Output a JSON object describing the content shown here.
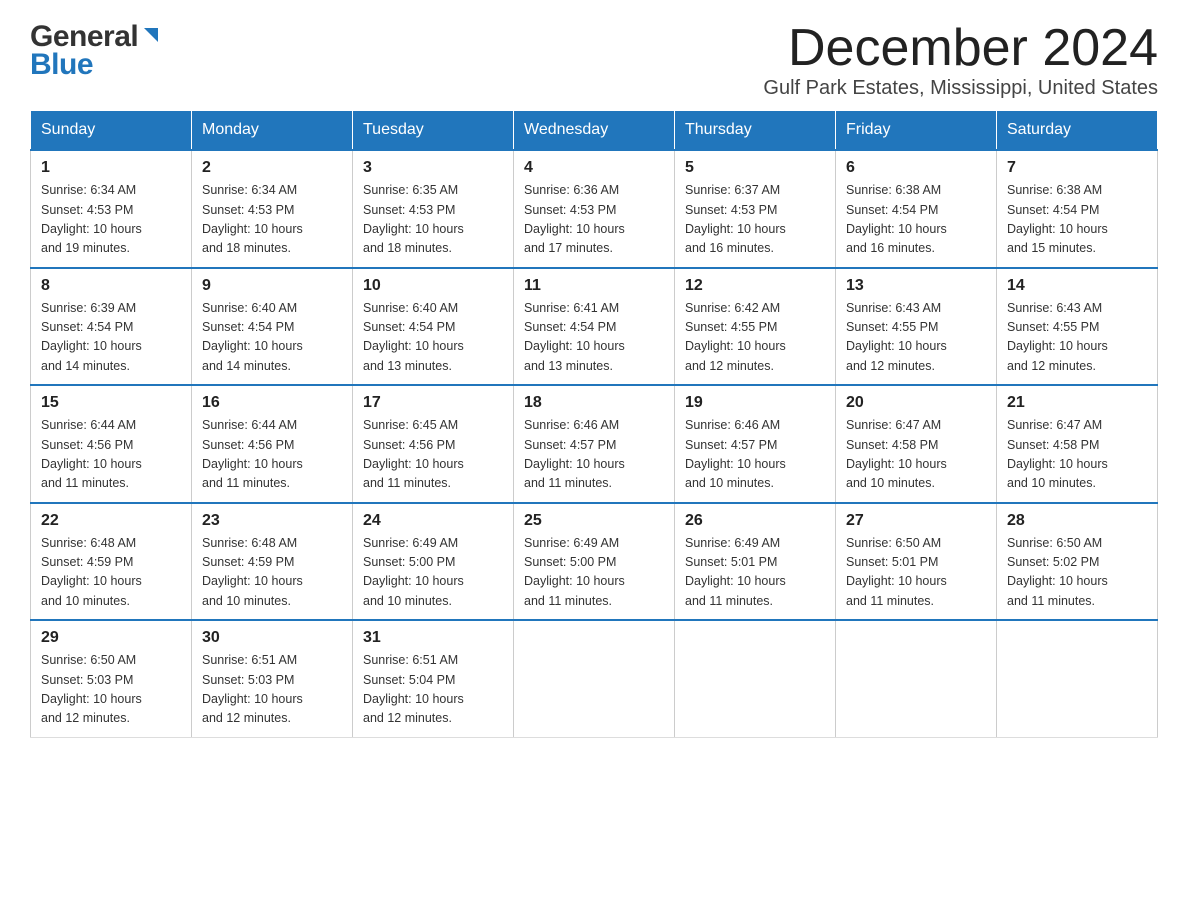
{
  "header": {
    "logo_general": "General",
    "logo_blue": "Blue",
    "month_title": "December 2024",
    "location": "Gulf Park Estates, Mississippi, United States"
  },
  "days_of_week": [
    "Sunday",
    "Monday",
    "Tuesday",
    "Wednesday",
    "Thursday",
    "Friday",
    "Saturday"
  ],
  "weeks": [
    [
      {
        "day": "1",
        "sunrise": "6:34 AM",
        "sunset": "4:53 PM",
        "daylight": "10 hours and 19 minutes."
      },
      {
        "day": "2",
        "sunrise": "6:34 AM",
        "sunset": "4:53 PM",
        "daylight": "10 hours and 18 minutes."
      },
      {
        "day": "3",
        "sunrise": "6:35 AM",
        "sunset": "4:53 PM",
        "daylight": "10 hours and 18 minutes."
      },
      {
        "day": "4",
        "sunrise": "6:36 AM",
        "sunset": "4:53 PM",
        "daylight": "10 hours and 17 minutes."
      },
      {
        "day": "5",
        "sunrise": "6:37 AM",
        "sunset": "4:53 PM",
        "daylight": "10 hours and 16 minutes."
      },
      {
        "day": "6",
        "sunrise": "6:38 AM",
        "sunset": "4:54 PM",
        "daylight": "10 hours and 16 minutes."
      },
      {
        "day": "7",
        "sunrise": "6:38 AM",
        "sunset": "4:54 PM",
        "daylight": "10 hours and 15 minutes."
      }
    ],
    [
      {
        "day": "8",
        "sunrise": "6:39 AM",
        "sunset": "4:54 PM",
        "daylight": "10 hours and 14 minutes."
      },
      {
        "day": "9",
        "sunrise": "6:40 AM",
        "sunset": "4:54 PM",
        "daylight": "10 hours and 14 minutes."
      },
      {
        "day": "10",
        "sunrise": "6:40 AM",
        "sunset": "4:54 PM",
        "daylight": "10 hours and 13 minutes."
      },
      {
        "day": "11",
        "sunrise": "6:41 AM",
        "sunset": "4:54 PM",
        "daylight": "10 hours and 13 minutes."
      },
      {
        "day": "12",
        "sunrise": "6:42 AM",
        "sunset": "4:55 PM",
        "daylight": "10 hours and 12 minutes."
      },
      {
        "day": "13",
        "sunrise": "6:43 AM",
        "sunset": "4:55 PM",
        "daylight": "10 hours and 12 minutes."
      },
      {
        "day": "14",
        "sunrise": "6:43 AM",
        "sunset": "4:55 PM",
        "daylight": "10 hours and 12 minutes."
      }
    ],
    [
      {
        "day": "15",
        "sunrise": "6:44 AM",
        "sunset": "4:56 PM",
        "daylight": "10 hours and 11 minutes."
      },
      {
        "day": "16",
        "sunrise": "6:44 AM",
        "sunset": "4:56 PM",
        "daylight": "10 hours and 11 minutes."
      },
      {
        "day": "17",
        "sunrise": "6:45 AM",
        "sunset": "4:56 PM",
        "daylight": "10 hours and 11 minutes."
      },
      {
        "day": "18",
        "sunrise": "6:46 AM",
        "sunset": "4:57 PM",
        "daylight": "10 hours and 11 minutes."
      },
      {
        "day": "19",
        "sunrise": "6:46 AM",
        "sunset": "4:57 PM",
        "daylight": "10 hours and 10 minutes."
      },
      {
        "day": "20",
        "sunrise": "6:47 AM",
        "sunset": "4:58 PM",
        "daylight": "10 hours and 10 minutes."
      },
      {
        "day": "21",
        "sunrise": "6:47 AM",
        "sunset": "4:58 PM",
        "daylight": "10 hours and 10 minutes."
      }
    ],
    [
      {
        "day": "22",
        "sunrise": "6:48 AM",
        "sunset": "4:59 PM",
        "daylight": "10 hours and 10 minutes."
      },
      {
        "day": "23",
        "sunrise": "6:48 AM",
        "sunset": "4:59 PM",
        "daylight": "10 hours and 10 minutes."
      },
      {
        "day": "24",
        "sunrise": "6:49 AM",
        "sunset": "5:00 PM",
        "daylight": "10 hours and 10 minutes."
      },
      {
        "day": "25",
        "sunrise": "6:49 AM",
        "sunset": "5:00 PM",
        "daylight": "10 hours and 11 minutes."
      },
      {
        "day": "26",
        "sunrise": "6:49 AM",
        "sunset": "5:01 PM",
        "daylight": "10 hours and 11 minutes."
      },
      {
        "day": "27",
        "sunrise": "6:50 AM",
        "sunset": "5:01 PM",
        "daylight": "10 hours and 11 minutes."
      },
      {
        "day": "28",
        "sunrise": "6:50 AM",
        "sunset": "5:02 PM",
        "daylight": "10 hours and 11 minutes."
      }
    ],
    [
      {
        "day": "29",
        "sunrise": "6:50 AM",
        "sunset": "5:03 PM",
        "daylight": "10 hours and 12 minutes."
      },
      {
        "day": "30",
        "sunrise": "6:51 AM",
        "sunset": "5:03 PM",
        "daylight": "10 hours and 12 minutes."
      },
      {
        "day": "31",
        "sunrise": "6:51 AM",
        "sunset": "5:04 PM",
        "daylight": "10 hours and 12 minutes."
      },
      null,
      null,
      null,
      null
    ]
  ],
  "labels": {
    "sunrise": "Sunrise:",
    "sunset": "Sunset:",
    "daylight": "Daylight:"
  }
}
